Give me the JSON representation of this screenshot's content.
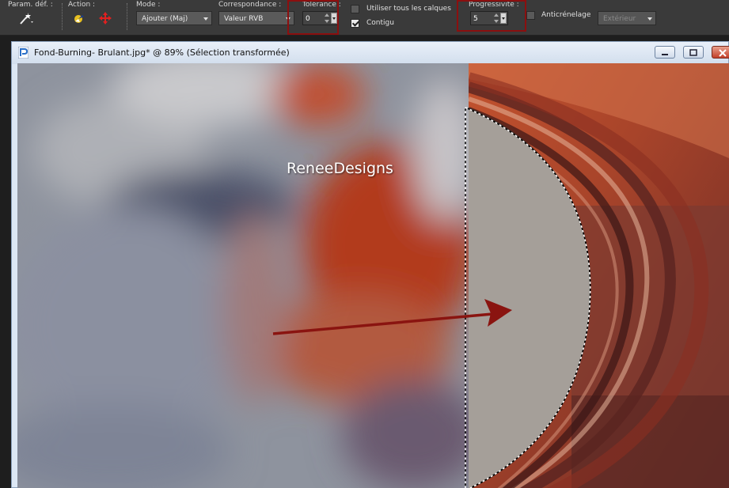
{
  "toolbar": {
    "preset_label": "Param. déf. :",
    "action_label": "Action :",
    "mode": {
      "label": "Mode :",
      "value": "Ajouter (Maj)"
    },
    "match": {
      "label": "Correspondance :",
      "value": "Valeur RVB"
    },
    "tolerance": {
      "label": "Tolérance :",
      "value": "0"
    },
    "use_all_layers": {
      "label": "Utiliser tous les calques",
      "checked": false
    },
    "contiguous": {
      "label": "Contigu",
      "checked": true
    },
    "feather": {
      "label": "Progressivité :",
      "value": "5"
    },
    "antialias": {
      "label": "Anticrénelage",
      "checked": false
    },
    "antialias_mode": {
      "value": "Extérieur",
      "disabled": true
    },
    "highlight_color": "#8b0f0f"
  },
  "window": {
    "title": "Fond-Burning- Brulant.jpg* @  89% (Sélection transformée)",
    "buttons": [
      "minimize-icon",
      "maximize-icon",
      "close-icon"
    ]
  },
  "canvas": {
    "watermark": "ReneeDesigns",
    "arrow_color": "#8a1410"
  }
}
